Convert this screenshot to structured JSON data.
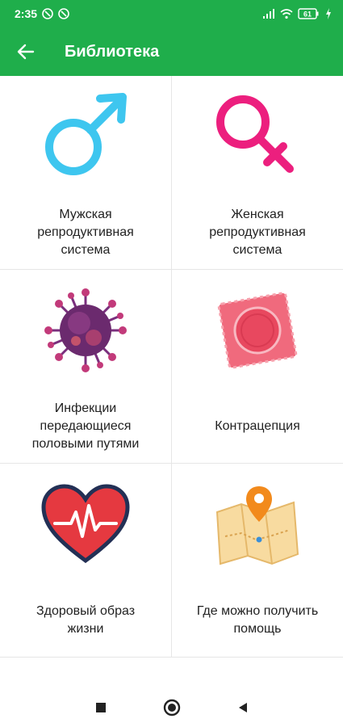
{
  "status_bar": {
    "time": "2:35",
    "battery": "61"
  },
  "app_bar": {
    "title": "Библиотека"
  },
  "tiles": [
    {
      "label": "Мужская\nрепродуктивная\nсистема",
      "icon": "male-symbol-icon",
      "color": "#3ec6ef"
    },
    {
      "label": "Женская\nрепродуктивная\nсистема",
      "icon": "female-symbol-icon",
      "color": "#ec1f7e"
    },
    {
      "label": "Инфекции\nпередающиеся\nполовыми путями",
      "icon": "virus-icon",
      "color": "#7a2f7d"
    },
    {
      "label": "Контрацепция",
      "icon": "condom-icon",
      "color": "#f06a7d"
    },
    {
      "label": "Здоровый образ\nжизни",
      "icon": "heart-pulse-icon",
      "color": "#e53940"
    },
    {
      "label": "Где можно получить\nпомощь",
      "icon": "map-pin-icon",
      "color": "#f28a1c"
    }
  ],
  "colors": {
    "accent": "#1fae4b"
  }
}
